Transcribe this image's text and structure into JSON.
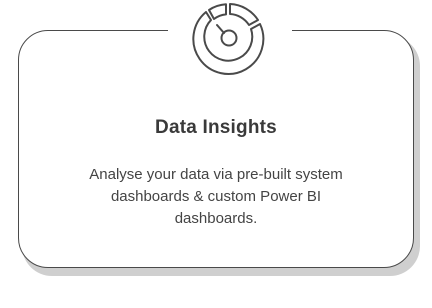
{
  "card": {
    "icon": "pie-chart-segments-icon",
    "title": "Data Insights",
    "description": "Analyse your data via pre-built system dashboards & custom Power BI dashboards."
  },
  "colors": {
    "border": "#4a4a4a",
    "shadow": "#cfcfcf",
    "text": "#444444"
  }
}
